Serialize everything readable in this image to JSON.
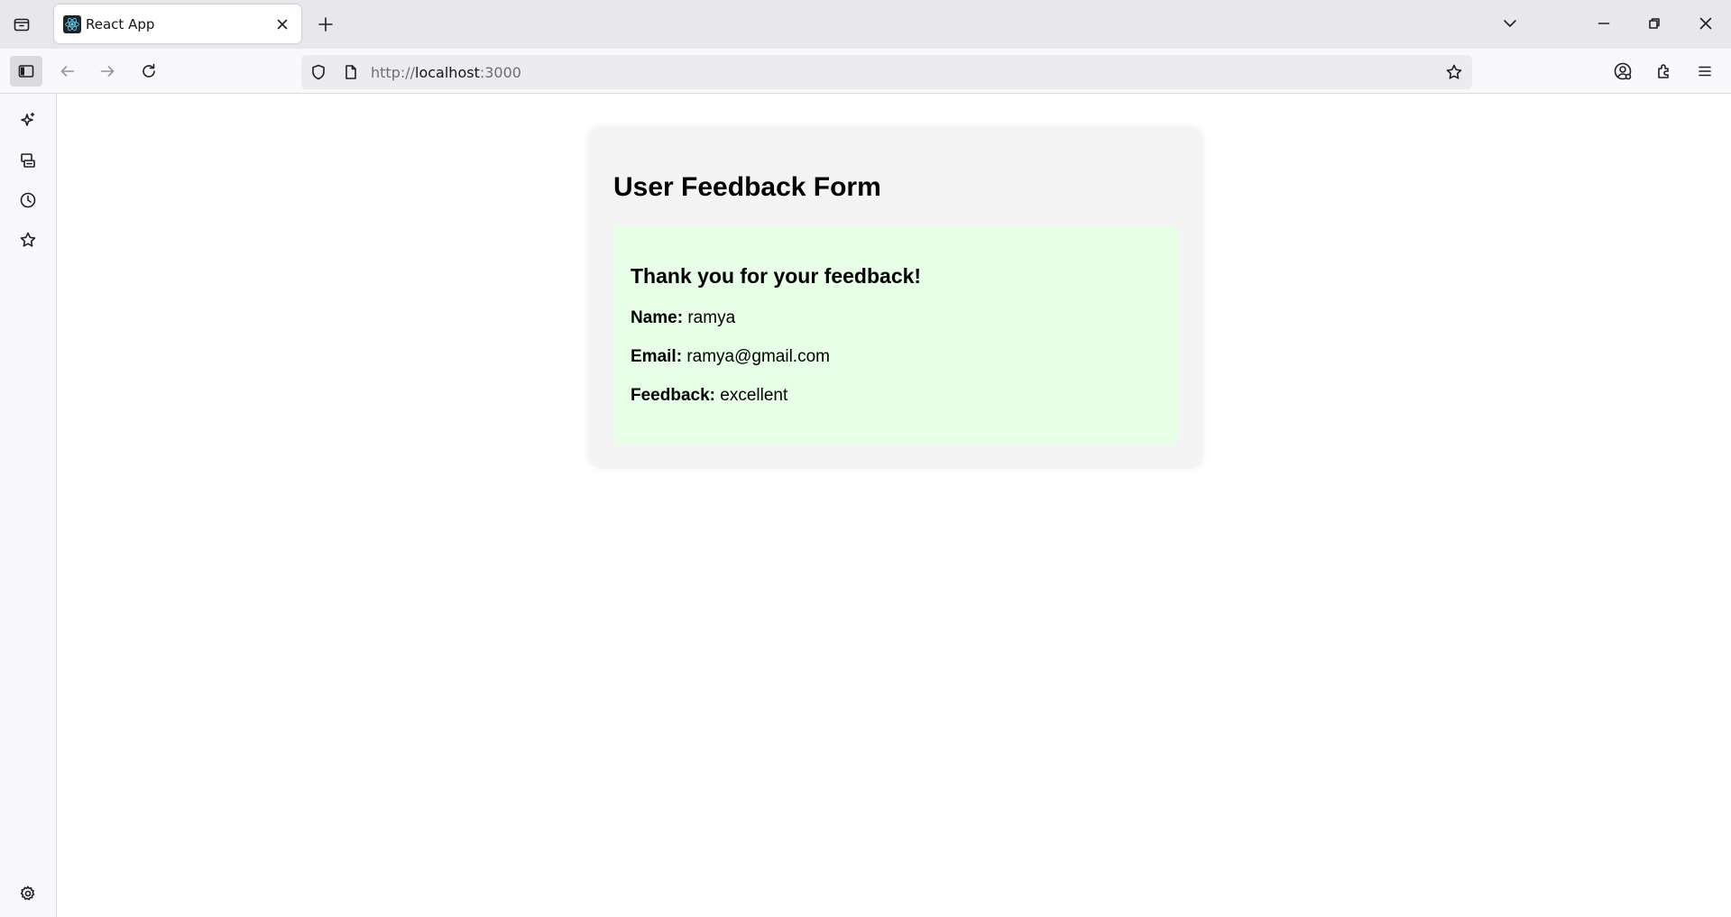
{
  "browser": {
    "tab": {
      "title": "React App"
    },
    "url": {
      "scheme": "http://",
      "host": "localhost",
      "port": ":3000"
    }
  },
  "page": {
    "form_title": "User Feedback Form",
    "result": {
      "heading": "Thank you for your feedback!",
      "name_label": "Name:",
      "name_value": "ramya",
      "email_label": "Email:",
      "email_value": "ramya@gmail.com",
      "feedback_label": "Feedback:",
      "feedback_value": "excellent"
    }
  },
  "colors": {
    "card_background": "#f4f4f4",
    "result_background": "#e6ffe6",
    "react_logo": "#61dafb"
  },
  "icons": {
    "tab_strip": [
      "tab-list-icon",
      "react-logo-icon",
      "close-icon",
      "plus-icon",
      "chevron-down-icon",
      "minimize-icon",
      "restore-icon",
      "window-close-icon"
    ],
    "toolbar": [
      "sidebar-icon",
      "back-arrow-icon",
      "forward-arrow-icon",
      "reload-icon",
      "shield-icon",
      "page-icon",
      "star-icon",
      "account-icon",
      "extensions-icon",
      "menu-icon"
    ],
    "sidebar": [
      "ai-sparkle-icon",
      "synced-tabs-icon",
      "history-icon",
      "bookmarks-star-icon",
      "settings-gear-icon"
    ]
  }
}
